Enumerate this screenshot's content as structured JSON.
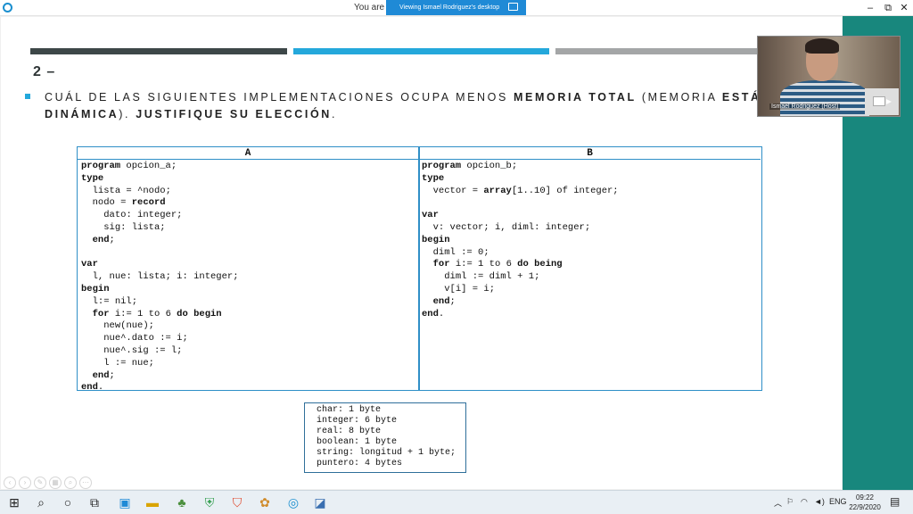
{
  "titlebar": {
    "partial_text": "You are v",
    "share_banner": "Viewing Ismael Rodriguez's desktop",
    "minimize": "–",
    "restore": "⧉",
    "close": "✕"
  },
  "slide": {
    "number": "2 –",
    "question_line1_pre": "CUÁL DE LAS SIGUIENTES IMPLEMENTACIONES OCUPA MENOS ",
    "question_line1_bold": "MEMORIA TOTAL",
    "question_line1_post": " (MEMORIA ",
    "question_line1_bold2": "ESTÁTIC",
    "question_line2_bold": "DINÁMICA",
    "question_line2_mid": "). ",
    "question_line2_bold2": "JUSTIFIQUE SU ELECCIÓN",
    "question_line2_end": ".",
    "table": {
      "col_a_header": "A",
      "col_b_header": "B",
      "col_a_lines": [
        "program opcion_a;",
        "type",
        "  lista = ^nodo;",
        "  nodo = record",
        "    dato: integer;",
        "    sig: lista;",
        "  end;",
        "",
        "var",
        "  l, nue: lista; i: integer;",
        "begin",
        "  l:= nil;",
        "  for i:= 1 to 6 do begin",
        "    new(nue);",
        "    nue^.dato := i;",
        "    nue^.sig := l;",
        "    l := nue;",
        "  end;",
        "end."
      ],
      "col_b_lines": [
        "program opcion_b;",
        "type",
        "  vector = array[1..10] of integer;",
        "",
        "var",
        "  v: vector; i, diml: integer;",
        "begin",
        "  diml := 0;",
        "  for i:= 1 to 6 do being",
        "    diml := diml + 1;",
        "    v[i] = i;",
        "  end;",
        "end."
      ],
      "keywords": [
        "program",
        "type",
        "record",
        "end",
        "var",
        "begin",
        "for",
        "do",
        "array",
        "being"
      ]
    },
    "sizes": [
      "char: 1 byte",
      "integer: 6 byte",
      "real: 8 byte",
      "boolean: 1 byte",
      "string: longitud + 1 byte;",
      "puntero: 4 bytes"
    ]
  },
  "webcam": {
    "host_label": "Ismael Rodriguez (Host)"
  },
  "taskbar": {
    "lang": "ENG",
    "time": "09:22",
    "date": "22/9/2020"
  },
  "colors": {
    "accent_blue": "#24a8db",
    "dark_bar": "#3d4748",
    "grey_bar": "#a4a6a7",
    "teal": "#18877d",
    "table_border": "#2f8fc7"
  }
}
